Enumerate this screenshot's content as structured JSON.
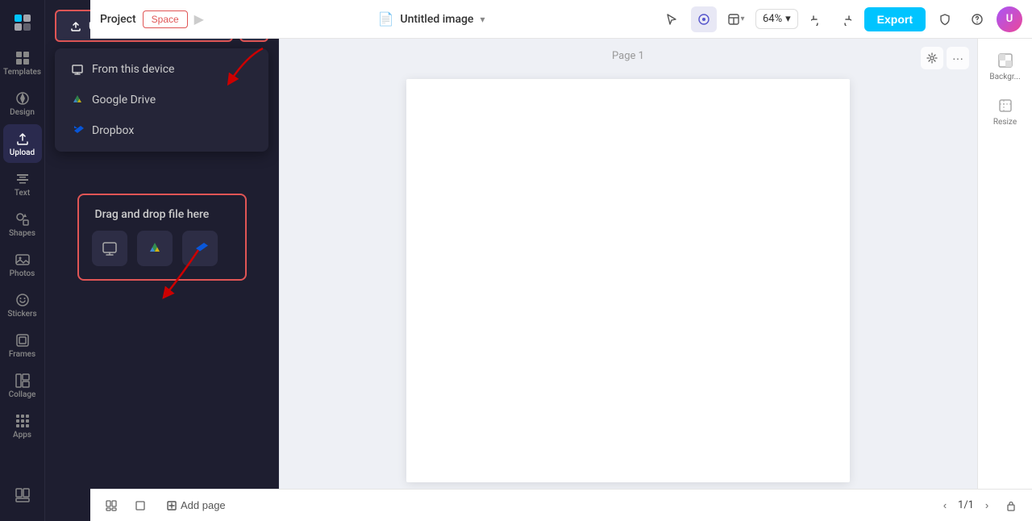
{
  "header": {
    "project_label": "Project",
    "space_label": "Space",
    "doc_title": "Untitled image",
    "zoom_level": "64%",
    "export_label": "Export"
  },
  "sidebar": {
    "items": [
      {
        "id": "templates",
        "label": "Templates",
        "icon": "grid"
      },
      {
        "id": "design",
        "label": "Design",
        "icon": "pen"
      },
      {
        "id": "upload",
        "label": "Upload",
        "icon": "upload",
        "active": true
      },
      {
        "id": "text",
        "label": "Text",
        "icon": "text"
      },
      {
        "id": "shapes",
        "label": "Shapes",
        "icon": "shapes"
      },
      {
        "id": "photos",
        "label": "Photos",
        "icon": "photos"
      },
      {
        "id": "stickers",
        "label": "Stickers",
        "icon": "stickers"
      },
      {
        "id": "frames",
        "label": "Frames",
        "icon": "frames"
      },
      {
        "id": "collage",
        "label": "Collage",
        "icon": "collage"
      },
      {
        "id": "apps",
        "label": "Apps",
        "icon": "apps"
      }
    ]
  },
  "upload_panel": {
    "upload_btn_label": "Upload",
    "dropdown": {
      "items": [
        {
          "id": "from-device",
          "label": "From this device"
        },
        {
          "id": "google-drive",
          "label": "Google Drive"
        },
        {
          "id": "dropbox",
          "label": "Dropbox"
        }
      ]
    },
    "drag_drop": {
      "label": "Drag and drop file here"
    }
  },
  "canvas": {
    "page_label": "Page 1"
  },
  "right_panel": {
    "items": [
      {
        "id": "background",
        "label": "Backgr..."
      },
      {
        "id": "resize",
        "label": "Resize"
      }
    ]
  },
  "bottom_bar": {
    "add_page_label": "Add page",
    "page_counter": "1/1"
  }
}
